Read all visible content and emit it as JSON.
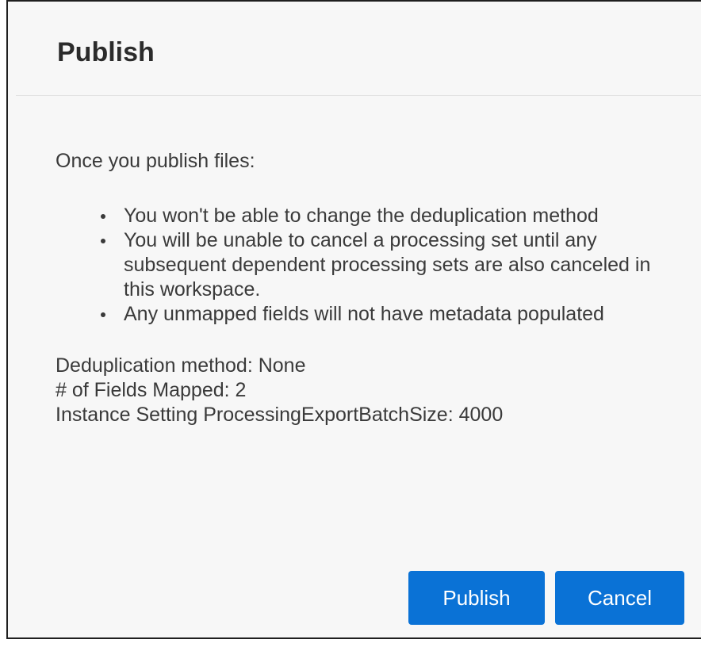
{
  "dialog": {
    "title": "Publish",
    "intro": "Once you publish files:",
    "bullets": [
      "You won't be able to change the deduplication method",
      "You will be unable to cancel a processing set until any subsequent dependent processing sets are also canceled in this workspace.",
      "Any unmapped fields will not have metadata populated"
    ],
    "details": [
      "Deduplication method: None",
      "# of Fields Mapped: 2",
      "Instance Setting ProcessingExportBatchSize: 4000"
    ],
    "buttons": {
      "publish_label": "Publish",
      "cancel_label": "Cancel"
    }
  },
  "colors": {
    "primary_button": "#0a72d6",
    "dialog_background": "#f7f7f7"
  }
}
